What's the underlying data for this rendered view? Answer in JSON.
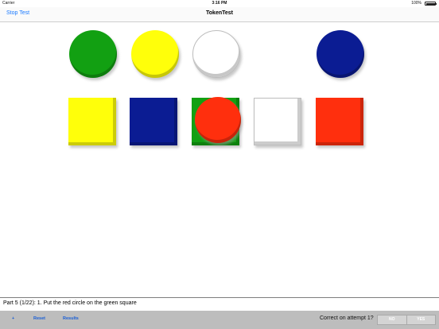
{
  "status_bar": {
    "carrier": "Carrier",
    "time": "3:16 PM",
    "battery": "100%"
  },
  "nav": {
    "title": "TokenTest",
    "left_button": "Stop Test"
  },
  "tokens": {
    "row1": [
      {
        "shape": "circle",
        "color_name": "green",
        "color": "#12a012"
      },
      {
        "shape": "circle",
        "color_name": "yellow",
        "color": "#ffff0a"
      },
      {
        "shape": "circle",
        "color_name": "white",
        "color": "#ffffff"
      },
      {
        "shape": "circle",
        "color_name": "blue",
        "color": "#0b1c93"
      }
    ],
    "row2": [
      {
        "shape": "square",
        "color_name": "yellow",
        "color": "#ffff0a"
      },
      {
        "shape": "square",
        "color_name": "blue",
        "color": "#0b1c93"
      },
      {
        "shape": "square",
        "color_name": "green",
        "color": "#12a012"
      },
      {
        "shape": "square",
        "color_name": "white",
        "color": "#ffffff"
      },
      {
        "shape": "square",
        "color_name": "red",
        "color": "#ff2f0d"
      }
    ],
    "placed": {
      "shape": "circle",
      "color_name": "red",
      "color": "#ff2f0d",
      "on": "green square"
    }
  },
  "prompt": {
    "text": "Part 5 (1/22): 1. Put the red circle on the green square"
  },
  "toolbar": {
    "plus_label": "+",
    "reset_label": "Reset",
    "results_label": "Results",
    "question": "Correct on attempt 1?",
    "no_label": "NO",
    "yes_label": "YES"
  }
}
